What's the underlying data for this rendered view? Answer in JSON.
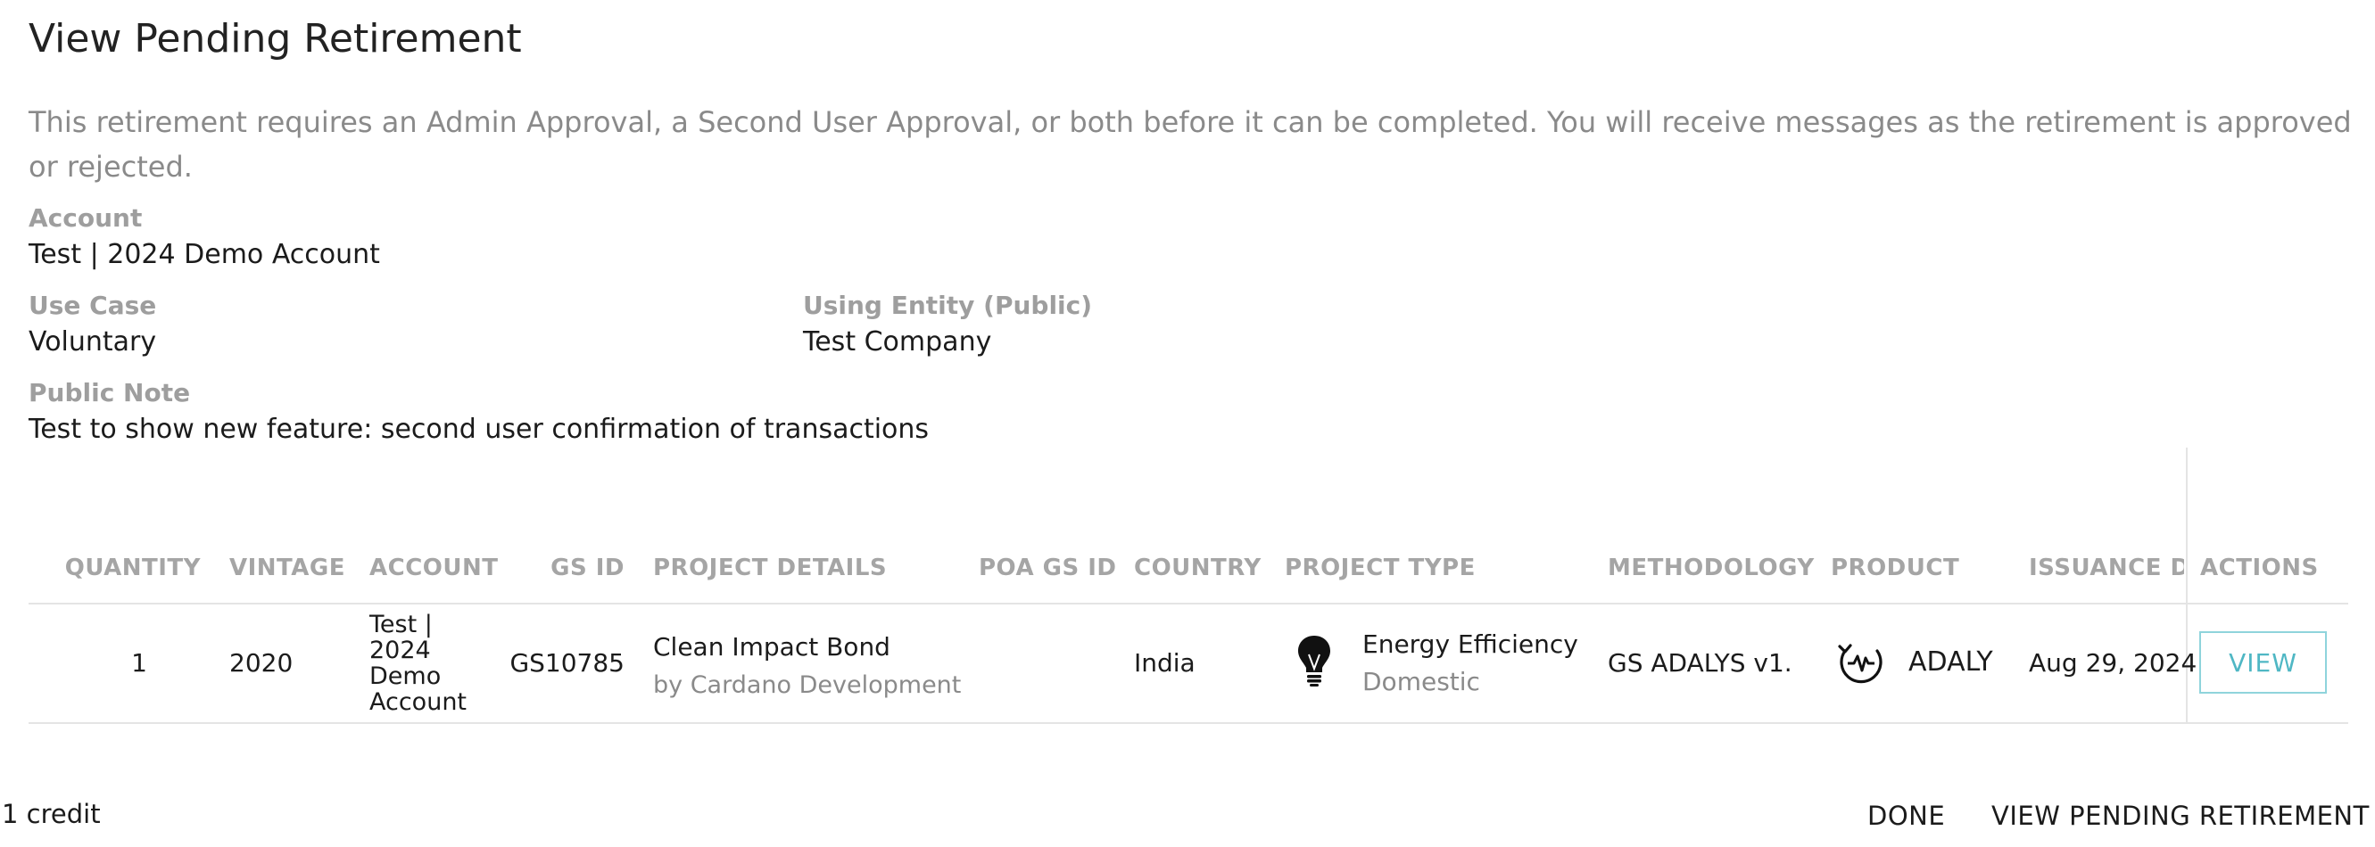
{
  "dialog": {
    "title": "View Pending Retirement",
    "description": "This retirement requires an Admin Approval, a Second User Approval, or both before it can be completed. You will receive messages as the retirement is approved or rejected."
  },
  "fields": {
    "account": {
      "label": "Account",
      "value": "Test | 2024 Demo Account"
    },
    "use_case": {
      "label": "Use Case",
      "value": "Voluntary"
    },
    "using_entity": {
      "label": "Using Entity (Public)",
      "value": "Test Company"
    },
    "public_note": {
      "label": "Public Note",
      "value": "Test to show new feature: second user confirmation of transactions"
    }
  },
  "table": {
    "headers": {
      "quantity": "QUANTITY",
      "vintage": "VINTAGE",
      "account": "ACCOUNT",
      "gs_id": "GS ID",
      "project_details": "PROJECT DETAILS",
      "poa_gs_id": "POA GS ID",
      "country": "COUNTRY",
      "project_type": "PROJECT TYPE",
      "methodology": "METHODOLOGY",
      "product": "PRODUCT",
      "issuance_date": "ISSUANCE DA",
      "actions": "ACTIONS"
    },
    "rows": [
      {
        "quantity": "1",
        "vintage": "2020",
        "account": "Test | 2024 Demo Account",
        "gs_id": "GS10785",
        "project_name": "Clean Impact Bond",
        "project_developer": "by Cardano Development",
        "poa_gs_id": "",
        "country": "India",
        "project_type": "Energy Efficiency",
        "project_subtype": "Domestic",
        "project_type_icon": "lightbulb-icon",
        "methodology": "GS ADALYS v1.",
        "product": "ADALY",
        "product_icon": "heartbeat-cycle-icon",
        "issuance_date": "Aug 29, 2024",
        "action_label": "VIEW"
      }
    ]
  },
  "footer": {
    "count": "1 credit",
    "done_label": "DONE",
    "view_pending_label": "VIEW PENDING RETIREMENT"
  },
  "colors": {
    "accent": "#4fb7c4",
    "muted_text": "#8a8a8a",
    "header_text": "#a5a5a5"
  }
}
